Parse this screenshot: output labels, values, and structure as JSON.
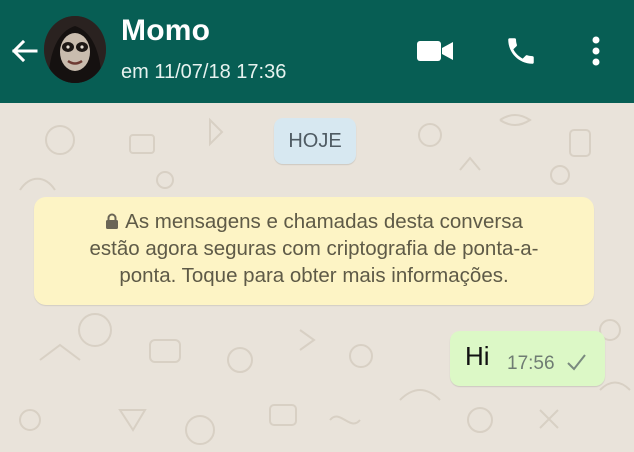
{
  "header": {
    "contact_name": "Momo",
    "last_seen": "em 11/07/18 17:36",
    "icons": [
      "back-arrow-icon",
      "video-call-icon",
      "phone-icon",
      "more-options-icon"
    ]
  },
  "chat": {
    "date_chip": "HOJE",
    "notice_line1": "As mensagens e chamadas desta conversa",
    "notice_line2": "estão agora seguras com criptografia de ponta-a-",
    "notice_line3": "ponta. Toque para obter mais informações.",
    "messages": [
      {
        "text": "Hi",
        "time": "17:56",
        "status": "sent"
      }
    ]
  },
  "colors": {
    "header": "#075e54",
    "background": "#e9e3da",
    "outgoing_bubble": "#dcf8c6",
    "notice": "#fdf4c5",
    "date_chip": "#d7e8f1"
  }
}
